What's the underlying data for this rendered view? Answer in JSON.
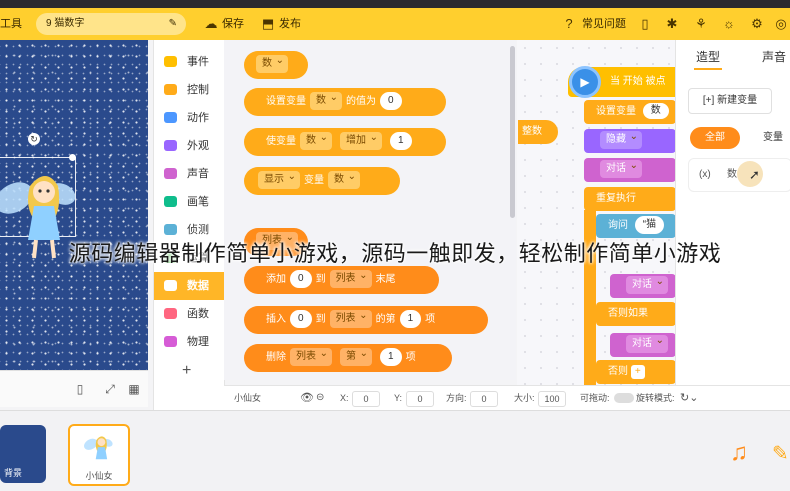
{
  "toolbar": {
    "menu_label": "工具",
    "project_name": "9 猫数字",
    "save_label": "保存",
    "publish_label": "发布",
    "faq_label": "常见问题"
  },
  "categories": [
    {
      "label": "事件",
      "color": "#ffbf00"
    },
    {
      "label": "控制",
      "color": "#ffab19"
    },
    {
      "label": "动作",
      "color": "#4c97ff"
    },
    {
      "label": "外观",
      "color": "#9966ff"
    },
    {
      "label": "声音",
      "color": "#cf63cf"
    },
    {
      "label": "画笔",
      "color": "#0fbd8c"
    },
    {
      "label": "侦测",
      "color": "#5cb1d6"
    },
    {
      "label": "运算",
      "color": "#59c059"
    },
    {
      "label": "数据",
      "color": "#ff8c1a"
    },
    {
      "label": "函数",
      "color": "#ff6680"
    },
    {
      "label": "物理",
      "color": "#d65cd6"
    }
  ],
  "palette": {
    "var_pill": "数",
    "set_var": {
      "prefix": "设置变量",
      "var": "数",
      "mid": "的值为",
      "value": "0"
    },
    "change_var": {
      "prefix": "使变量",
      "var": "数",
      "op": "增加",
      "value": "1"
    },
    "show_var": {
      "prefix": "显示",
      "mid": "变量",
      "var": "数"
    },
    "list_pill": "列表",
    "add_list": {
      "prefix": "添加",
      "value": "0",
      "mid": "到",
      "list": "列表",
      "suffix": "末尾"
    },
    "insert_list": {
      "prefix": "插入",
      "value": "0",
      "mid": "到",
      "list": "列表",
      "pos_label": "的第",
      "pos": "1",
      "suffix": "项"
    },
    "delete_list": {
      "prefix": "删除",
      "list": "列表",
      "pos_label": "第",
      "pos": "1",
      "suffix": "项"
    }
  },
  "script": {
    "hat_label": "当 开始 被点",
    "set_var": "设置变量",
    "set_var_val": "数",
    "hide": "隐藏",
    "say": "对话",
    "repeat": "重复执行",
    "ask": "询问",
    "ask_text": "“猫",
    "say2": "对话",
    "else_if": "否则如果",
    "say3": "对话",
    "else": "否则",
    "detached": "整数"
  },
  "right_panel": {
    "tab_costume": "造型",
    "tab_sound": "声音",
    "new_var": "[+] 新建变量",
    "seg_all": "全部",
    "seg_var": "变量",
    "var_icon": "(x)",
    "var_name": "数"
  },
  "props": {
    "sprite_name": "小仙女",
    "x_label": "X:",
    "x": "0",
    "y_label": "Y:",
    "y": "0",
    "dir_label": "方向:",
    "dir": "0",
    "size_label": "大小:",
    "size": "100",
    "drag_label": "可拖动:",
    "rotate_label": "旋转模式:"
  },
  "sprites": {
    "background_label": "背景",
    "sprite_label": "小仙女"
  },
  "caption": "源码编辑器制作简单小游戏，源码一触即发，轻松制作简单小游戏",
  "colors": {
    "toolbar": "#ffcf2e",
    "data_block": "#ffab19",
    "list_block": "#ff8c1a",
    "stage_bg": "#2a4a8c"
  }
}
